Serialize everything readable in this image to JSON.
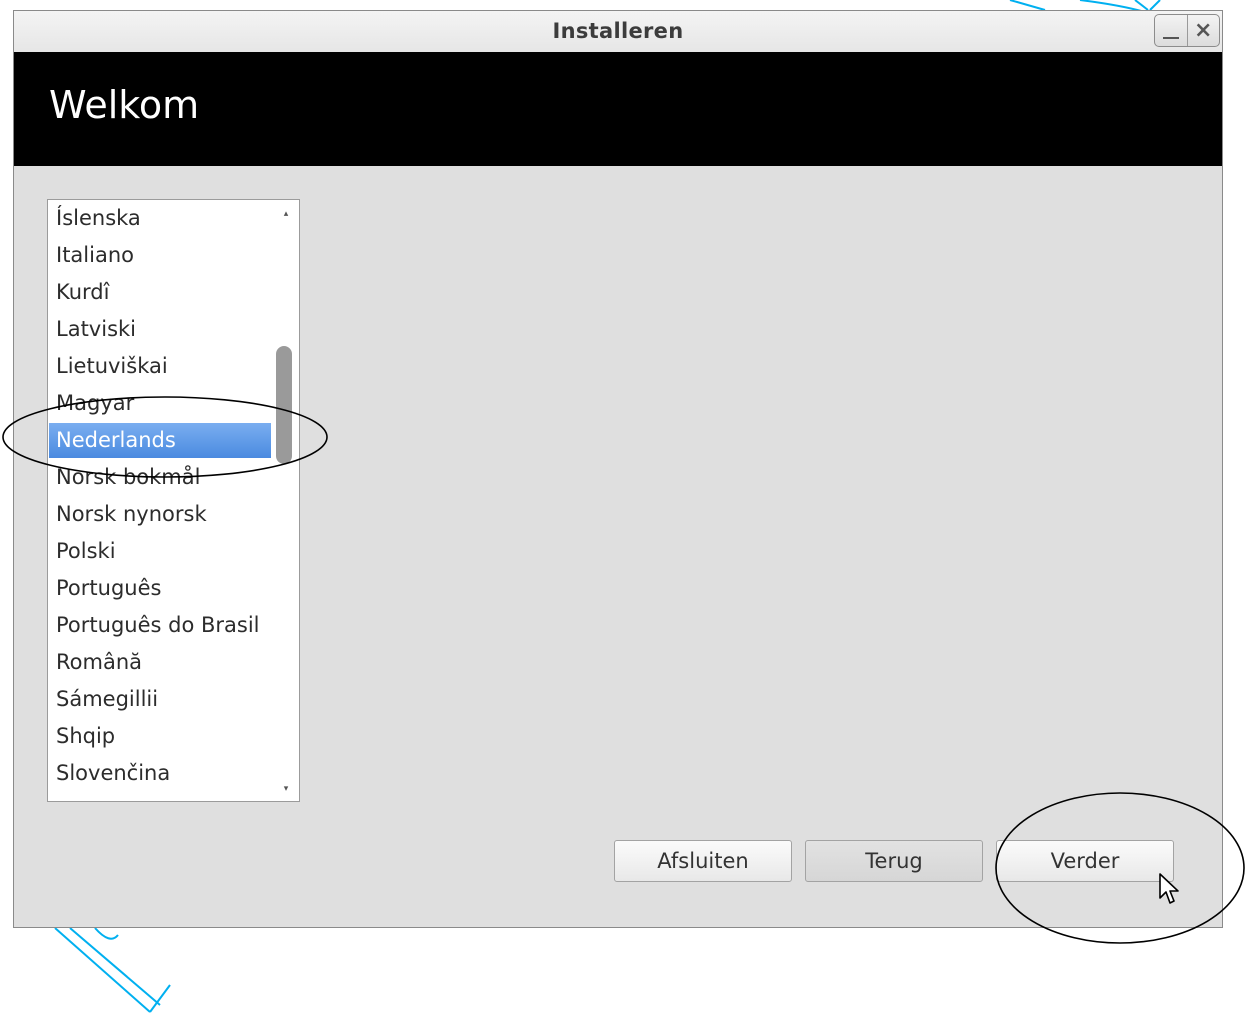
{
  "window": {
    "title": "Installeren",
    "close_symbol": "×"
  },
  "header": {
    "title": "Welkom"
  },
  "languages": {
    "items": [
      "Íslenska",
      "Italiano",
      "Kurdî",
      "Latviski",
      "Lietuviškai",
      "Magyar",
      "Nederlands",
      "Norsk bokmål",
      "Norsk nynorsk",
      "Polski",
      "Português",
      "Português do Brasil",
      "Română",
      "Sámegillii",
      "Shqip",
      "Slovenčina"
    ],
    "selected": "Nederlands",
    "selected_color": "#5b97e6"
  },
  "buttons": {
    "quit": "Afsluiten",
    "back": "Terug",
    "next": "Verder"
  },
  "colors": {
    "header_bg": "#000000",
    "window_bg": "#dfdfdf",
    "annotation_ring": "#000000",
    "ribbon": "#00b0f0"
  },
  "icons": {
    "minimize": "minimize-icon",
    "close": "close-icon",
    "scroll_up": "scroll-up-arrow-icon",
    "scroll_down": "scroll-down-arrow-icon",
    "cursor": "mouse-pointer-icon"
  }
}
